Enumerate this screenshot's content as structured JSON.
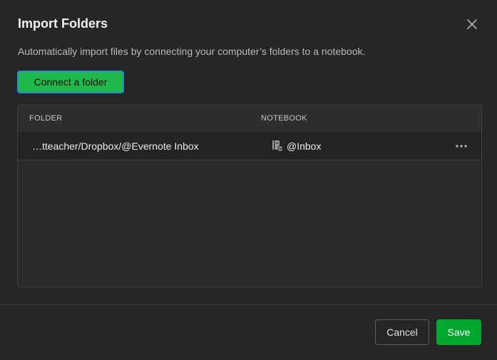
{
  "dialog": {
    "title": "Import Folders",
    "description": "Automatically import files by connecting your computer’s folders to a notebook.",
    "close_icon": "close-icon"
  },
  "actions": {
    "connect_label": "Connect a folder"
  },
  "table": {
    "headers": {
      "folder": "FOLDER",
      "notebook": "NOTEBOOK"
    },
    "rows": [
      {
        "folder": "…tteacher/Dropbox/@Evernote Inbox",
        "notebook": "@Inbox",
        "notebook_icon": "notebook-stack-icon",
        "more_icon": "more-horizontal-icon"
      }
    ]
  },
  "footer": {
    "cancel_label": "Cancel",
    "save_label": "Save"
  },
  "colors": {
    "background": "#262626",
    "accent_green": "#00a82d",
    "connect_green": "#1fb84a",
    "focus_ring": "#2a8ad8",
    "text_primary": "#ececec",
    "text_secondary": "#b8b8b8"
  }
}
